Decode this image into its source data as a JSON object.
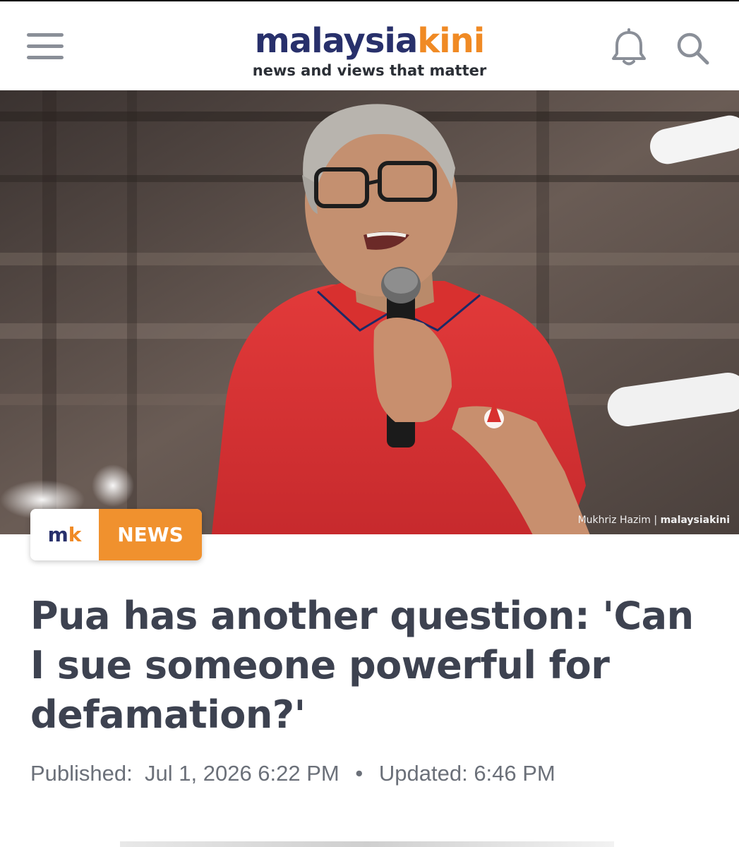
{
  "header": {
    "logo_part1": "malaysia",
    "logo_part2": "kini",
    "tagline": "news and views that matter"
  },
  "icons": {
    "menu": "hamburger-icon",
    "notifications": "bell-icon",
    "search": "search-icon"
  },
  "hero": {
    "credit_author": "Mukhriz Hazim",
    "credit_outlet": "malaysiakini"
  },
  "badge": {
    "logo_m": "m",
    "logo_k": "k",
    "label": "NEWS"
  },
  "article": {
    "headline": "Pua has another question: 'Can I sue someone powerful for defamation?'",
    "published_label": "Published:",
    "published_value": "Jul 1, 2026 6:22 PM",
    "separator": "•",
    "updated_label": "Updated:",
    "updated_value": "6:46 PM"
  },
  "colors": {
    "brand_navy": "#28306b",
    "brand_orange": "#f08a24",
    "headline": "#3d4250",
    "meta": "#6b7079"
  }
}
